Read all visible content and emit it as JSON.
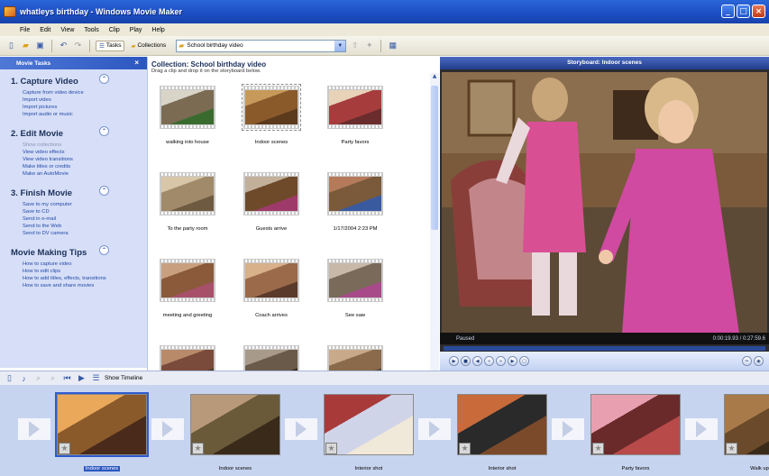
{
  "window": {
    "title": "whatleys birthday - Windows Movie Maker"
  },
  "menu": [
    "File",
    "Edit",
    "View",
    "Tools",
    "Clip",
    "Play",
    "Help"
  ],
  "toolbar": {
    "tasks_label": "Tasks",
    "collections_label": "Collections",
    "collection_select": "School birthday video"
  },
  "tasks_pane": {
    "header": "Movie Tasks",
    "sections": [
      {
        "title": "1. Capture Video",
        "links": [
          "Capture from video device",
          "Import video",
          "Import pictures",
          "Import audio or music"
        ],
        "dim": [
          false,
          false,
          false,
          false
        ]
      },
      {
        "title": "2. Edit Movie",
        "links": [
          "Show collections",
          "View video effects",
          "View video transitions",
          "Make titles or credits",
          "Make an AutoMovie"
        ],
        "dim": [
          true,
          false,
          false,
          false,
          false
        ]
      },
      {
        "title": "3. Finish Movie",
        "links": [
          "Save to my computer",
          "Save to CD",
          "Send in e-mail",
          "Send to the Web",
          "Send to DV camera"
        ],
        "dim": [
          false,
          false,
          false,
          false,
          false
        ]
      },
      {
        "title": "Movie Making Tips",
        "links": [
          "How to capture video",
          "How to edit clips",
          "How to add titles, effects, transitions",
          "How to save and share movies"
        ],
        "dim": [
          false,
          false,
          false,
          false
        ]
      }
    ]
  },
  "collection": {
    "title": "Collection: School birthday video",
    "subtitle": "Drag a clip and drop it on the storyboard below.",
    "clips": [
      {
        "label": "walking into house"
      },
      {
        "label": "Indoor scenes",
        "selected": true
      },
      {
        "label": "Party favors"
      },
      {
        "label": "To the party room"
      },
      {
        "label": "Guests arrive"
      },
      {
        "label": "1/17/2004 2:23 PM"
      },
      {
        "label": "meeting and greeting"
      },
      {
        "label": "Coach arrives"
      },
      {
        "label": "See saw"
      },
      {
        "label": ""
      },
      {
        "label": ""
      },
      {
        "label": ""
      }
    ]
  },
  "preview": {
    "title": "Storyboard: Indoor scenes",
    "status": "Paused",
    "time": "0:00:19.93 / 0:27:59.6"
  },
  "storyboard": {
    "toolbar_label": "Show Timeline",
    "frames": [
      {
        "label": "Indoor scenes",
        "selected": true
      },
      {
        "label": "Indoor scenes"
      },
      {
        "label": "Interior shot"
      },
      {
        "label": "Interior shot"
      },
      {
        "label": "Party favors"
      },
      {
        "label": "Walk up to party"
      }
    ]
  },
  "colors": {
    "accent": "#2c57c0",
    "task_pane": "#d6dff7",
    "storyboard_bg": "#c7d4ef"
  },
  "icons": [
    "new-project-icon",
    "open-icon",
    "save-icon",
    "undo-icon",
    "redo-icon",
    "tasks-icon",
    "collections-icon",
    "up-folder-icon",
    "views-icon",
    "play-icon",
    "stop-icon",
    "rewind-icon",
    "forward-icon",
    "split-icon",
    "snapshot-icon",
    "star-icon"
  ]
}
